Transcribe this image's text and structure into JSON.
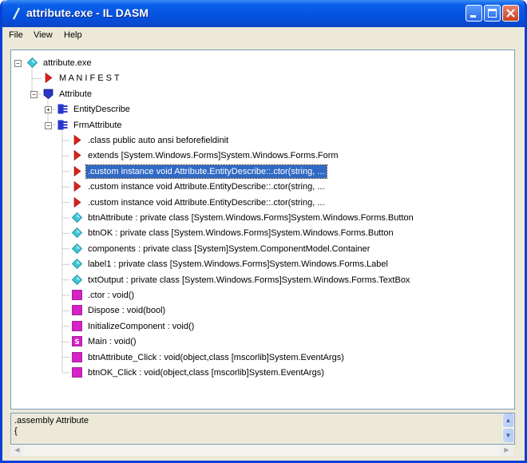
{
  "window": {
    "title": "attribute.exe - IL DASM"
  },
  "menu": [
    "File",
    "View",
    "Help"
  ],
  "tree": [
    {
      "label": "attribute.exe",
      "icon": "assembly-icon"
    },
    {
      "label": "M A N I F E S T",
      "icon": "manifest-icon"
    },
    {
      "label": "Attribute",
      "icon": "namespace-icon"
    },
    {
      "label": "EntityDescribe",
      "icon": "class-icon"
    },
    {
      "label": "FrmAttribute",
      "icon": "class-icon"
    },
    {
      "label": ".class public auto ansi beforefieldinit",
      "icon": "info-icon"
    },
    {
      "label": "extends [System.Windows.Forms]System.Windows.Forms.Form",
      "icon": "info-icon"
    },
    {
      "label": ".custom instance void Attribute.EntityDescribe::.ctor(string, ...",
      "icon": "custom-attribute-icon",
      "selected": true
    },
    {
      "label": ".custom instance void Attribute.EntityDescribe::.ctor(string, ...",
      "icon": "custom-attribute-icon"
    },
    {
      "label": ".custom instance void Attribute.EntityDescribe::.ctor(string, ...",
      "icon": "custom-attribute-icon"
    },
    {
      "label": "btnAttribute : private class [System.Windows.Forms]System.Windows.Forms.Button",
      "icon": "field-icon"
    },
    {
      "label": "btnOK : private class [System.Windows.Forms]System.Windows.Forms.Button",
      "icon": "field-icon"
    },
    {
      "label": "components : private class [System]System.ComponentModel.Container",
      "icon": "field-icon"
    },
    {
      "label": "label1 : private class [System.Windows.Forms]System.Windows.Forms.Label",
      "icon": "field-icon"
    },
    {
      "label": "txtOutput : private class [System.Windows.Forms]System.Windows.Forms.TextBox",
      "icon": "field-icon"
    },
    {
      "label": ".ctor : void()",
      "icon": "method-icon"
    },
    {
      "label": "Dispose : void(bool)",
      "icon": "method-icon"
    },
    {
      "label": "InitializeComponent : void()",
      "icon": "method-icon"
    },
    {
      "label": "Main : void()",
      "icon": "static-method-icon"
    },
    {
      "label": "btnAttribute_Click : void(object,class [mscorlib]System.EventArgs)",
      "icon": "method-icon"
    },
    {
      "label": "btnOK_Click : void(object,class [mscorlib]System.EventArgs)",
      "icon": "method-icon"
    }
  ],
  "status": {
    "text": ".assembly Attribute\n{"
  },
  "colors": {
    "title_bar": "#0551e0",
    "selection": "#316ac5"
  }
}
